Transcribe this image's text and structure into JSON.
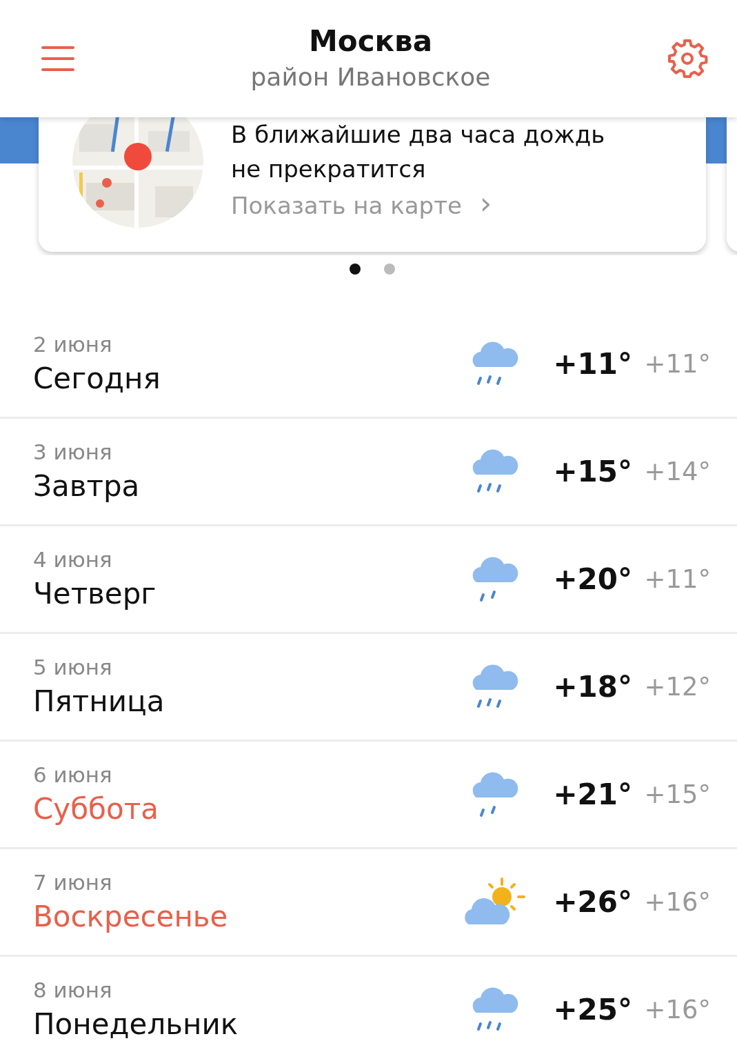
{
  "header": {
    "title": "Москва",
    "subtitle": "район Ивановское"
  },
  "nowcast": {
    "message": "В ближайшие два часа дождь не прекратится",
    "link": "Показать на карте",
    "chevron": "›"
  },
  "pager": [
    {
      "selected": true
    },
    {
      "selected": false
    }
  ],
  "days": [
    {
      "date": "2 июня",
      "day": "Сегодня",
      "weekend": false,
      "kind": "rain",
      "high": "+11°",
      "low": "+11°"
    },
    {
      "date": "3 июня",
      "day": "Завтра",
      "weekend": false,
      "kind": "rain",
      "high": "+15°",
      "low": "+14°"
    },
    {
      "date": "4 июня",
      "day": "Четверг",
      "weekend": false,
      "kind": "light-rain",
      "high": "+20°",
      "low": "+11°"
    },
    {
      "date": "5 июня",
      "day": "Пятница",
      "weekend": false,
      "kind": "rain",
      "high": "+18°",
      "low": "+12°"
    },
    {
      "date": "6 июня",
      "day": "Суббота",
      "weekend": true,
      "kind": "light-rain",
      "high": "+21°",
      "low": "+15°"
    },
    {
      "date": "7 июня",
      "day": "Воскресенье",
      "weekend": true,
      "kind": "partly-sunny",
      "high": "+26°",
      "low": "+16°"
    },
    {
      "date": "8 июня",
      "day": "Понедельник",
      "weekend": false,
      "kind": "rain",
      "high": "+25°",
      "low": "+16°"
    }
  ]
}
